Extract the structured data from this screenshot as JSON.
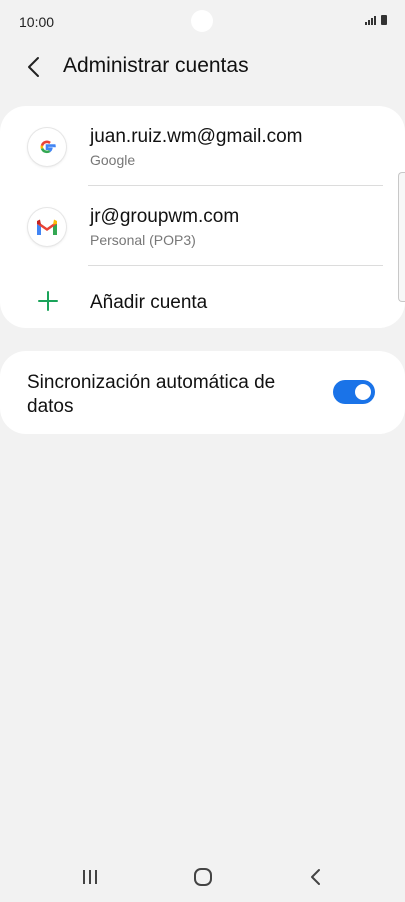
{
  "status_bar": {
    "time": "10:00"
  },
  "header": {
    "title": "Administrar cuentas",
    "back_icon": "chevron-left-icon"
  },
  "accounts": [
    {
      "name": "juan.ruiz.wm@gmail.com",
      "type": "Google",
      "icon": "google-icon"
    },
    {
      "name": "jr@groupwm.com",
      "type": "Personal (POP3)",
      "icon": "gmail-icon"
    }
  ],
  "add_account": {
    "label": "Añadir cuenta",
    "icon": "plus-icon",
    "icon_color": "#1aa35a"
  },
  "sync": {
    "label": "Sincronización automática de datos",
    "enabled": true,
    "toggle_color": "#1a73e8"
  },
  "nav_bar": {
    "buttons": [
      "recents-icon",
      "home-icon",
      "back-icon"
    ]
  }
}
